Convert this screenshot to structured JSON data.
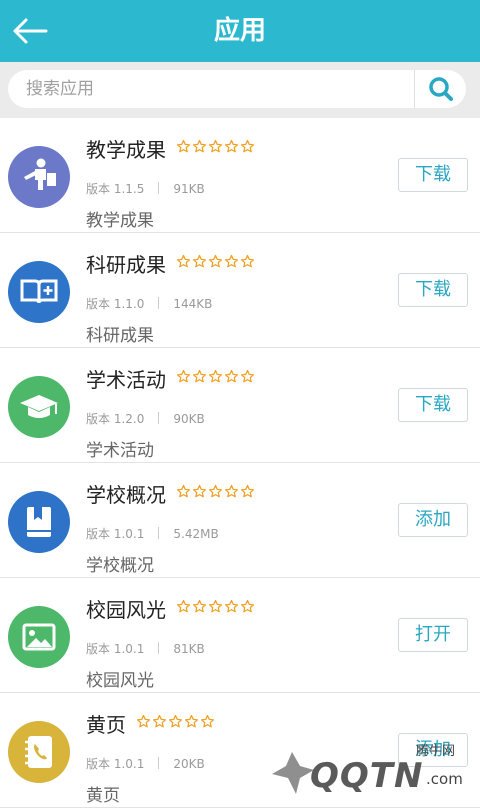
{
  "header": {
    "title": "应用"
  },
  "search": {
    "placeholder": "搜索应用"
  },
  "version_prefix": "版本",
  "apps": [
    {
      "name": "教学成果",
      "version": "1.1.5",
      "size": "91KB",
      "description": "教学成果",
      "action": "下载",
      "icon": "teacher-icon",
      "color": "#6b79c8"
    },
    {
      "name": "科研成果",
      "version": "1.1.0",
      "size": "144KB",
      "description": "科研成果",
      "action": "下载",
      "icon": "book-plus-icon",
      "color": "#2e75c9"
    },
    {
      "name": "学术活动",
      "version": "1.2.0",
      "size": "90KB",
      "description": "学术活动",
      "action": "下载",
      "icon": "graduation-cap-icon",
      "color": "#4db86a"
    },
    {
      "name": "学校概况",
      "version": "1.0.1",
      "size": "5.42MB",
      "description": "学校概况",
      "action": "添加",
      "icon": "bookmark-book-icon",
      "color": "#2f73c8"
    },
    {
      "name": "校园风光",
      "version": "1.0.1",
      "size": "81KB",
      "description": "校园风光",
      "action": "打开",
      "icon": "picture-icon",
      "color": "#4db86a"
    },
    {
      "name": "黄页",
      "version": "1.0.1",
      "size": "20KB",
      "description": "黄页",
      "action": "添加",
      "icon": "phone-book-icon",
      "color": "#d8b43a"
    }
  ],
  "colors": {
    "header": "#2cb8cf",
    "accent": "#2aa7c2",
    "star": "#f0a020"
  },
  "watermark": {
    "top": "腾牛网",
    "main": "QQTN",
    "suffix": ".com"
  }
}
